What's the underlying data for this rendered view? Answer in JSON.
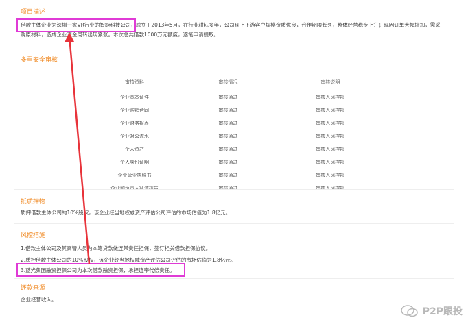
{
  "sections": {
    "project": {
      "title": "项目描述",
      "text": "借款主体企业为深圳一家VR行业的智能科技公司，成立于2013年5月，在行业耕耘多年，公司现上下游客户规模资质优良，合作期限长久，整体经营稳步上升；现因订单大幅增加，需采购原材料，造成企业资金周转出现紧张。本次总共借款1000万元额度，逐笔申请提取。"
    },
    "audit": {
      "title": "多重安全审核",
      "headers": [
        "审核资料",
        "审核情况",
        "审核说明"
      ],
      "rows": [
        [
          "企业基本证件",
          "审核通过",
          "审核人风控部"
        ],
        [
          "企业购销合同",
          "审核通过",
          "审核人风控部"
        ],
        [
          "企业财务报表",
          "审核通过",
          "审核人风控部"
        ],
        [
          "企业对公流水",
          "审核通过",
          "审核人风控部"
        ],
        [
          "个人资产",
          "审核通过",
          "审核人风控部"
        ],
        [
          "个人身份证明",
          "审核通过",
          "审核人风控部"
        ],
        [
          "企业营业执照书",
          "审核通过",
          "审核人风控部"
        ],
        [
          "企业和负责人征信报告",
          "审核通过",
          "审核人风控部"
        ]
      ]
    },
    "collateral": {
      "title": "抵质押物",
      "text": "质押借款主体公司的10%股权，该企业经当地权威资产评估公司评估的市场估值为1.8亿元。"
    },
    "risk": {
      "title": "风控措施",
      "items": [
        "1.借款主体公司及其高管人员为本笔贷款做连带责任担保，签订相关借款担保协议。",
        "2.质押借款主体公司的10%股权，该企业经当地权威资产评估公司评估的市场估值为1.8亿元。",
        "3.蓝光集团融资担保公司为本次借款融资担保，承担连带代偿责任。"
      ]
    },
    "repayment": {
      "title": "还款来源",
      "text": "企业经营收入。"
    }
  },
  "watermark": {
    "text": "P2P跟投",
    "icon": "wechat-icon"
  },
  "colors": {
    "section_title": "#f08a24",
    "highlight_box": "#e03bd6",
    "arrow": "#e8333a"
  }
}
